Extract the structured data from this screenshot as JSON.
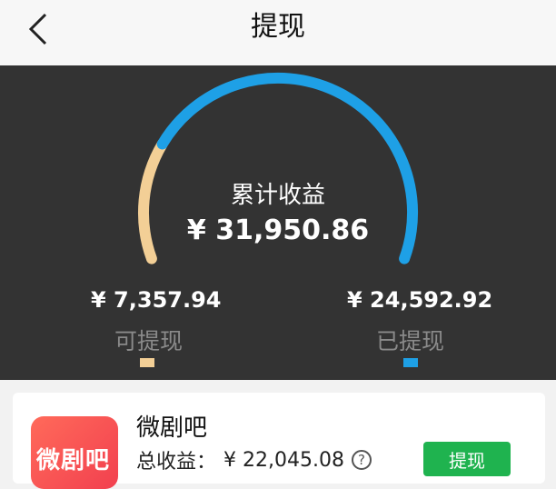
{
  "header": {
    "title": "提现",
    "back_icon": "chevron-left-icon"
  },
  "summary": {
    "total_label": "累计收益",
    "total_value": "¥ 31,950.86",
    "available": {
      "value": "¥ 7,357.94",
      "label": "可提现",
      "color": "#f3cf96"
    },
    "withdrawn": {
      "value": "¥ 24,592.92",
      "label": "已提现",
      "color": "#1ea0e6"
    },
    "available_fraction": 0.2303
  },
  "app_card": {
    "icon_text": "微剧吧",
    "name": "微剧吧",
    "earning_label": "总收益：",
    "earning_value": "¥ 22,045.08",
    "help_icon": "question-circle-icon",
    "withdraw_label": "提现"
  }
}
